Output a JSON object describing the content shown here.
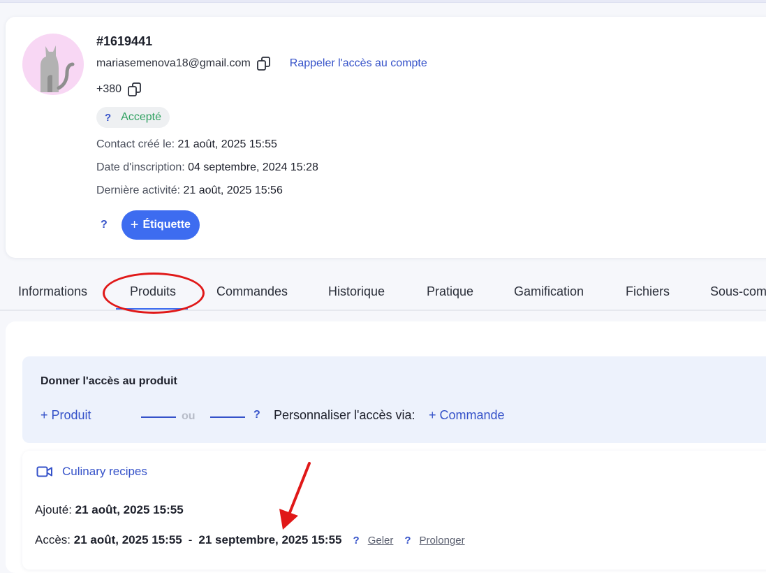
{
  "contact": {
    "id": "#1619441",
    "email": "mariasemenova18@gmail.com",
    "recall_link": "Rappeler l'accès au compte",
    "phone": "+380",
    "status_help": "?",
    "status": "Accepté",
    "created_label": "Contact créé le:",
    "created_value": "21 août, 2025 15:55",
    "registered_label": "Date d'inscription:",
    "registered_value": "04 septembre, 2024 15:28",
    "last_activity_label": "Dernière activité:",
    "last_activity_value": "21 août, 2025 15:56",
    "tag_help": "?",
    "tag_button": "Étiquette",
    "tag_plus": "+"
  },
  "tabs": [
    "Informations",
    "Produits",
    "Commandes",
    "Historique",
    "Pratique",
    "Gamification",
    "Fichiers",
    "Sous-com"
  ],
  "active_tab": "Produits",
  "grant": {
    "title": "Donner l'accès au produit",
    "add_product": "+ Produit",
    "or": "ou",
    "help": "?",
    "personalize_label": "Personnaliser l'accès via:",
    "order_link": "+ Commande"
  },
  "product": {
    "title": "Culinary recipes",
    "icon": "video-icon",
    "added_label": "Ajouté:",
    "added_value": "21 août, 2025 15:55",
    "access_label": "Accès:",
    "access_start": "21 août, 2025 15:55",
    "access_sep": "-",
    "access_end": "21 septembre, 2025 15:55",
    "freeze_help": "?",
    "freeze": "Geler",
    "extend_help": "?",
    "extend": "Prolonger"
  },
  "colors": {
    "accent": "#3d6cf0",
    "link": "#3552c9",
    "success": "#2fa160",
    "annotation": "#e01818",
    "avatar_bg": "#f8d7f4"
  }
}
